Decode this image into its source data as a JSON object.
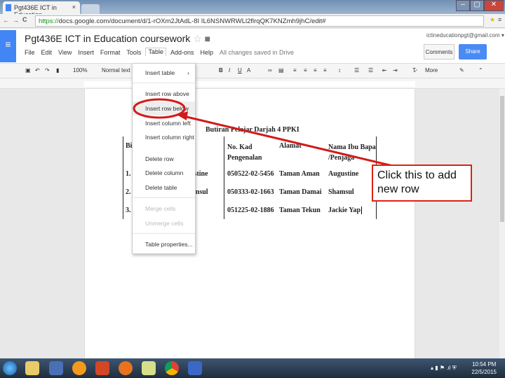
{
  "browser": {
    "tab_title": "Pgt436E ICT in Education",
    "url_scheme": "https://",
    "url_rest": "docs.google.com/document/d/1-rOXm2JtAdL-8I IL6NSNWRWLl2flrqQK7KNZmh9jhC/edit#"
  },
  "docs": {
    "title": "Pgt436E ICT in Education coursework",
    "account": "ictineducationpgt@gmail.com ▾",
    "comments_label": "Comments",
    "share_label": "Share",
    "menus": [
      "File",
      "Edit",
      "View",
      "Insert",
      "Format",
      "Tools",
      "Table",
      "Add-ons",
      "Help"
    ],
    "active_menu": "Table",
    "save_status": "All changes saved in Drive"
  },
  "toolbar": {
    "zoom": "100%",
    "style": "Normal text",
    "more": "More"
  },
  "table_menu": {
    "items": [
      {
        "label": "Insert table",
        "disabled": false
      },
      {
        "label": "Insert row above",
        "disabled": false
      },
      {
        "label": "Insert row below",
        "disabled": false,
        "highlighted": true
      },
      {
        "label": "Insert column left",
        "disabled": false
      },
      {
        "label": "Insert column right",
        "disabled": false
      },
      {
        "label": "Delete row",
        "disabled": false
      },
      {
        "label": "Delete column",
        "disabled": false
      },
      {
        "label": "Delete table",
        "disabled": false
      },
      {
        "label": "Merge cells",
        "disabled": true
      },
      {
        "label": "Unmerge cells",
        "disabled": true
      },
      {
        "label": "Table properties...",
        "disabled": false
      }
    ]
  },
  "document": {
    "heading": "Butiran Pelajar Darjah 4 PPKI",
    "headers": [
      "Bil",
      "",
      "No. Kad Pengenalan",
      "Alamat",
      "Nama Ibu Bapa /Penjaga"
    ],
    "rows": [
      [
        "1.",
        "ustine",
        "050522-02-5456",
        "Taman Aman",
        "Augustine"
      ],
      [
        "2.",
        "amsul",
        "050333-02-1663",
        "Taman Damai",
        "Shamsul"
      ],
      [
        "3.",
        "",
        "051225-02-1886",
        "Taman Tekun",
        "Jackie Yap"
      ]
    ]
  },
  "annotation": {
    "callout": "Click this to add new row",
    "color": "#d21a1a"
  },
  "taskbar": {
    "time": "10:54 PM",
    "date": "22/5/2015"
  }
}
